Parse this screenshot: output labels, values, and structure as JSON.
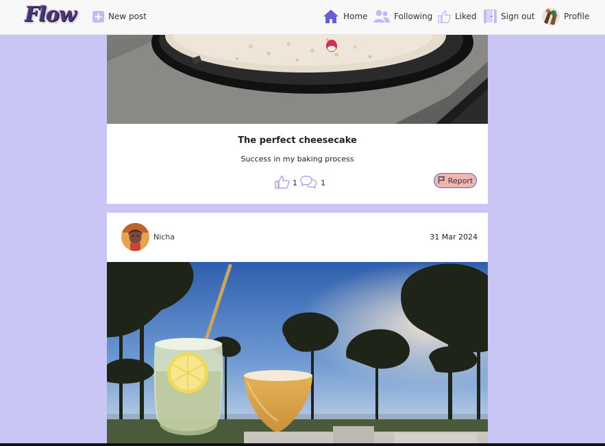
{
  "nav": {
    "logo": "Flow",
    "new_post": "New post",
    "home": "Home",
    "following": "Following",
    "liked": "Liked",
    "sign_out": "Sign out",
    "profile": "Profile"
  },
  "posts": [
    {
      "title": "The perfect cheesecake",
      "description": "Success in my baking process",
      "likes": "1",
      "comments": "1",
      "report_label": "Report"
    },
    {
      "author": "Nicha",
      "date": "31 Mar 2024"
    }
  ],
  "colors": {
    "background": "#c9c6f5",
    "nav_background": "#f8f8f8",
    "icon_accent": "#6a5fd0",
    "icon_light": "#c0bcf0",
    "report_fill": "#f0b4b1",
    "report_border": "#3d6fd3"
  },
  "icons": {
    "new_post": "plus-square-icon",
    "home": "house-icon",
    "following": "users-icon",
    "liked": "thumbs-up-icon",
    "sign_out": "door-icon",
    "like": "thumbs-up-icon",
    "comment": "comments-icon",
    "report": "flag-icon"
  }
}
